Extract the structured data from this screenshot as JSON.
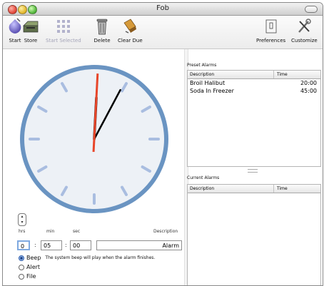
{
  "window": {
    "title": "Fob"
  },
  "toolbar": {
    "items": [
      {
        "id": "start",
        "label": "Start",
        "icon": "start-icon"
      },
      {
        "id": "store",
        "label": "Store",
        "icon": "store-icon"
      },
      {
        "id": "start_selected",
        "label": "Start Selected",
        "icon": "grid-icon",
        "disabled": true
      },
      {
        "id": "delete",
        "label": "Delete",
        "icon": "trash-icon"
      },
      {
        "id": "clear_due",
        "label": "Clear Due",
        "icon": "clear-due-icon"
      },
      {
        "id": "preferences",
        "label": "Preferences",
        "icon": "preferences-icon"
      },
      {
        "id": "customize",
        "label": "Customize",
        "icon": "customize-icon"
      }
    ]
  },
  "timer": {
    "hrs_label": "hrs",
    "min_label": "min",
    "sec_label": "sec",
    "description_label": "Description",
    "hrs_value": "0",
    "min_value": "05",
    "sec_value": "00",
    "description_value": "Alarm",
    "beep_note": "The system beep will play when the alarm finishes.",
    "options": [
      "Beep",
      "Alert",
      "File"
    ],
    "selected_option": "Beep"
  },
  "clock": {
    "hours": 12,
    "minutes": 0,
    "seconds": 1,
    "colors": {
      "rim": "#6a94c2",
      "face": "#edf1f6",
      "tick": "#a9bde0",
      "hand": "#000000",
      "second_hand": "#e8462a"
    }
  },
  "preset_alarms": {
    "title": "Preset Alarms",
    "columns": [
      "Description",
      "Time"
    ],
    "rows": [
      {
        "description": "Broil Halibut",
        "time": "20:00"
      },
      {
        "description": "Soda In Freezer",
        "time": "45:00"
      }
    ]
  },
  "current_alarms": {
    "title": "Current Alarms",
    "columns": [
      "Description",
      "Time"
    ],
    "rows": []
  }
}
